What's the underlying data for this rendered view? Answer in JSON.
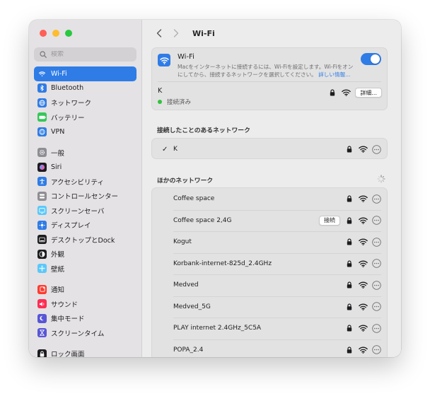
{
  "window": {
    "title": "Wi-Fi"
  },
  "sidebar": {
    "search_placeholder": "検索",
    "items": [
      {
        "label": "Wi-Fi",
        "icon": "wifi-icon",
        "color": "#2f7ce6",
        "active": true
      },
      {
        "label": "Bluetooth",
        "icon": "bluetooth-icon",
        "color": "#2f7ce6"
      },
      {
        "label": "ネットワーク",
        "icon": "globe-icon",
        "color": "#2f7ce6"
      },
      {
        "label": "バッテリー",
        "icon": "battery-icon",
        "color": "#34c759"
      },
      {
        "label": "VPN",
        "icon": "vpn-globe-icon",
        "color": "#2f7ce6"
      },
      {
        "label": "一般",
        "icon": "gear-icon",
        "color": "#8e8e93"
      },
      {
        "label": "Siri",
        "icon": "siri-icon",
        "color": "#1c1c1e"
      },
      {
        "label": "アクセシビリティ",
        "icon": "accessibility-icon",
        "color": "#2f7ce6"
      },
      {
        "label": "コントロールセンター",
        "icon": "control-center-icon",
        "color": "#8e8e93"
      },
      {
        "label": "スクリーンセーバ",
        "icon": "screensaver-icon",
        "color": "#5ac8fa"
      },
      {
        "label": "ディスプレイ",
        "icon": "sun-icon",
        "color": "#2f7ce6"
      },
      {
        "label": "デスクトップとDock",
        "icon": "dock-icon",
        "color": "#1c1c1e"
      },
      {
        "label": "外観",
        "icon": "appearance-icon",
        "color": "#1c1c1e"
      },
      {
        "label": "壁紙",
        "icon": "wallpaper-icon",
        "color": "#5ac8fa"
      },
      {
        "label": "通知",
        "icon": "bell-icon",
        "color": "#ff3b30"
      },
      {
        "label": "サウンド",
        "icon": "speaker-icon",
        "color": "#ff2d55"
      },
      {
        "label": "集中モード",
        "icon": "moon-icon",
        "color": "#5856d6"
      },
      {
        "label": "スクリーンタイム",
        "icon": "hourglass-icon",
        "color": "#5856d6"
      },
      {
        "label": "ロック画面",
        "icon": "lock-screen-icon",
        "color": "#1c1c1e"
      }
    ]
  },
  "wifi": {
    "title": "Wi-Fi",
    "description": "Macをインターネットに接続するには、Wi-Fiを設定します。Wi-Fiをオンにしてから、接続するネットワークを選択してください。",
    "learn_more": "詳しい情報...",
    "enabled": true,
    "current": {
      "name": "K",
      "status": "接続済み",
      "details_label": "詳細..."
    }
  },
  "known": {
    "title": "接続したことのあるネットワーク",
    "items": [
      {
        "name": "K",
        "connected": true
      }
    ]
  },
  "other": {
    "title": "ほかのネットワーク",
    "connect_label": "接続",
    "items": [
      {
        "name": "Coffee space"
      },
      {
        "name": "Coffee space 2,4G",
        "connect": true
      },
      {
        "name": "Kogut"
      },
      {
        "name": "Korbank-internet-825d_2.4GHz"
      },
      {
        "name": "Medved"
      },
      {
        "name": "Medved_5G"
      },
      {
        "name": "PLAY internet 2.4GHz_5C5A"
      },
      {
        "name": "POPA_2.4"
      }
    ]
  },
  "colors": {
    "accent": "#2f7ce6",
    "connected": "#31c23f"
  }
}
